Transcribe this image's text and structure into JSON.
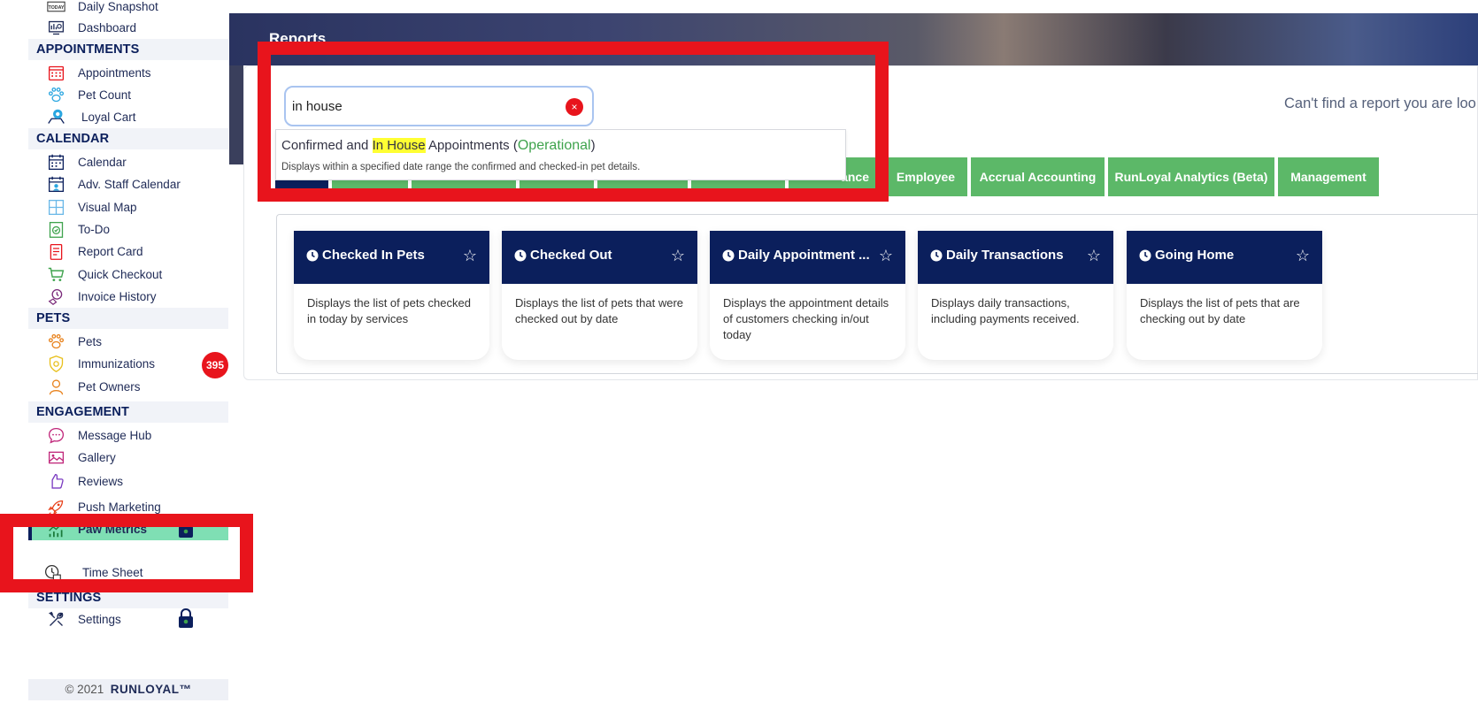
{
  "sidebar": {
    "sections": [
      {
        "label": "APPOINTMENTS"
      },
      {
        "label": "CALENDAR"
      },
      {
        "label": "PETS"
      },
      {
        "label": "ENGAGEMENT"
      },
      {
        "label": "SETTINGS"
      }
    ],
    "items": [
      {
        "label": "Daily Snapshot",
        "icon": "today-icon"
      },
      {
        "label": "Dashboard",
        "icon": "dashboard-icon"
      },
      {
        "label": "Appointments",
        "icon": "appointments-calendar-icon"
      },
      {
        "label": "Pet Count",
        "icon": "paw-icon"
      },
      {
        "label": "Loyal Cart",
        "icon": "cart-icon"
      },
      {
        "label": "Calendar",
        "icon": "calendar-icon"
      },
      {
        "label": "Adv. Staff Calendar",
        "icon": "staff-calendar-icon"
      },
      {
        "label": "Visual Map",
        "icon": "map-icon"
      },
      {
        "label": "To-Do",
        "icon": "todo-icon"
      },
      {
        "label": "Report Card",
        "icon": "report-card-icon"
      },
      {
        "label": "Quick Checkout",
        "icon": "checkout-cart-icon"
      },
      {
        "label": "Invoice History",
        "icon": "invoice-icon"
      },
      {
        "label": "Pets",
        "icon": "paw-icon"
      },
      {
        "label": "Immunizations",
        "icon": "immunization-icon",
        "badge": "395"
      },
      {
        "label": "Pet Owners",
        "icon": "person-icon"
      },
      {
        "label": "Message Hub",
        "icon": "chat-icon"
      },
      {
        "label": "Gallery",
        "icon": "gallery-icon"
      },
      {
        "label": "Reviews",
        "icon": "thumbs-up-icon"
      },
      {
        "label": "Push Marketing",
        "icon": "rocket-icon"
      },
      {
        "label": "Paw Metrics",
        "icon": "metrics-chart-icon",
        "active": true
      },
      {
        "label": "Time Sheet",
        "icon": "clock-icon"
      },
      {
        "label": "Settings",
        "icon": "tools-icon"
      }
    ],
    "footer_copy": "© 2021",
    "footer_brand": "RUNLOYAL™"
  },
  "main": {
    "page_title": "Reports",
    "search": {
      "value": "in house",
      "clear_label": "×"
    },
    "dropdown": {
      "title_prefix": "Confirmed and ",
      "title_highlight": "In House",
      "title_suffix": " Appointments (",
      "category": "Operational",
      "title_close": ")",
      "description": "Displays within a specified date range the confirmed and checked-in pet details."
    },
    "cant_find": "Can't find a report you are loo",
    "tabs": [
      {
        "label": "",
        "selected": true
      },
      {
        "label": ""
      },
      {
        "label": ""
      },
      {
        "label": ""
      },
      {
        "label": ""
      },
      {
        "label": ""
      },
      {
        "label": "ance"
      },
      {
        "label": "Employee"
      },
      {
        "label": "Accrual Accounting"
      },
      {
        "label": "RunLoyal Analytics (Beta)"
      },
      {
        "label": "Management"
      }
    ],
    "cards": [
      {
        "title": "Checked In Pets",
        "description": "Displays the list of pets checked in today by services"
      },
      {
        "title": "Checked Out",
        "description": "Displays the list of pets that were checked out by date"
      },
      {
        "title": "Daily Appointment ...",
        "description": "Displays the appointment details of customers checking in/out today"
      },
      {
        "title": "Daily Transactions",
        "description": "Displays daily transactions, including payments received."
      },
      {
        "title": "Going Home",
        "description": "Displays the list of pets that are checking out by date"
      }
    ],
    "star_glyph": "☆"
  },
  "colors": {
    "navy": "#0b1f5c",
    "green_tab": "#5cb868",
    "active_item": "#7fdfb4",
    "badge_red": "#e8141c",
    "annotation_red": "#e8141c",
    "highlight": "#ffff33"
  }
}
